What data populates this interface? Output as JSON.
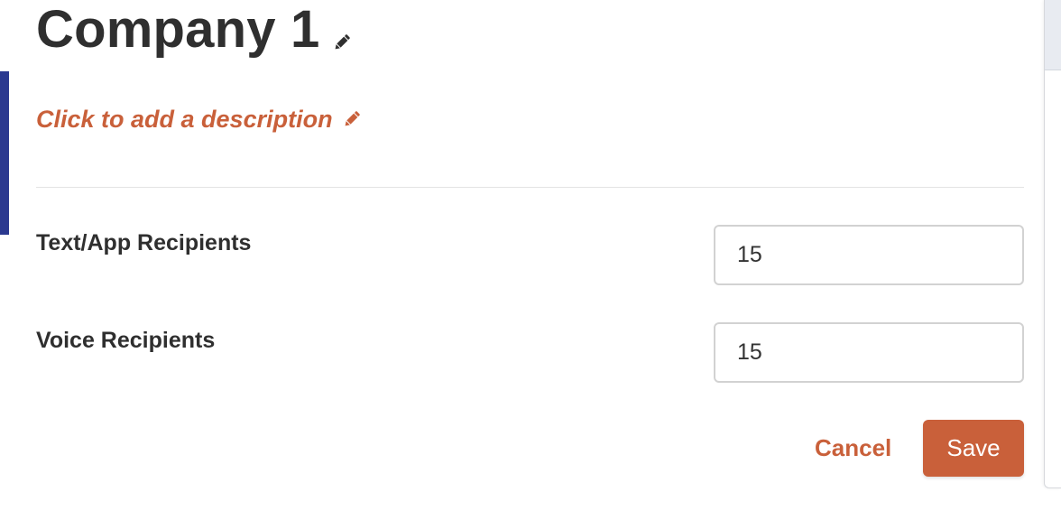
{
  "header": {
    "title": "Company 1",
    "edit_icon": "pencil-icon"
  },
  "description": {
    "placeholder_text": "Click to add a description",
    "edit_icon": "pencil-icon"
  },
  "form": {
    "fields": [
      {
        "label": "Text/App Recipients",
        "value": "15"
      },
      {
        "label": "Voice Recipients",
        "value": "15"
      }
    ],
    "cancel_label": "Cancel",
    "save_label": "Save"
  },
  "colors": {
    "accent": "#c9603a",
    "sidebar_accent": "#2b3990",
    "text": "#2f2f2f"
  }
}
